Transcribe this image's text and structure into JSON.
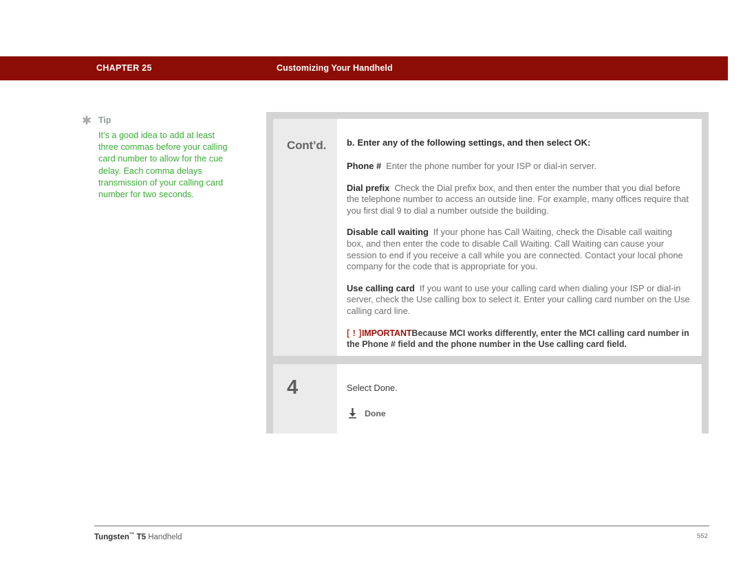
{
  "header": {
    "chapter": "CHAPTER 25",
    "title": "Customizing Your Handheld",
    "bar_color": "#8c0d06"
  },
  "tip": {
    "icon": "asterisk-icon",
    "label": "Tip",
    "text": "It’s a good idea to add at least three commas before your calling card number to allow for the cue delay. Each comma delays transmission of your calling card number for two seconds.",
    "text_color": "#3cab37"
  },
  "steps": [
    {
      "marker": "Cont’d.",
      "lead_letter": "b.",
      "lead_text": "Enter any of the following settings, and then select OK:",
      "items": [
        {
          "term": "Phone #",
          "text": "Enter the phone number for your ISP or dial-in server."
        },
        {
          "term": "Dial prefix",
          "text": "Check the Dial prefix box, and then enter the number that you dial before the telephone number to access an outside line. For example, many offices require that you first dial 9 to dial a number outside the building."
        },
        {
          "term": "Disable call waiting",
          "text": "If your phone has Call Waiting, check the Disable call waiting box, and then enter the code to disable Call Waiting. Call Waiting can cause your session to end if you receive a call while you are connected. Contact your local phone company for the code that is appropriate for you."
        },
        {
          "term": "Use calling card",
          "text": "If you want to use your calling card when dialing your ISP or dial-in server, check the Use calling box to select it. Enter your calling card number on the Use calling card line."
        }
      ],
      "important": {
        "brackets": "[ ! ]",
        "label": "IMPORTANT",
        "text": "Because MCI works differently, enter the MCI calling card number in the Phone # field and the phone number in the Use calling card field.",
        "label_color": "#9a1109"
      }
    },
    {
      "marker": "4",
      "text": "Select Done.",
      "button": {
        "icon": "download-arrow-icon",
        "label": "Done"
      }
    }
  ],
  "footer": {
    "product": "Tungsten",
    "trademark": "™",
    "model": " T5",
    "suffix": " Handheld",
    "page_number": "552"
  }
}
